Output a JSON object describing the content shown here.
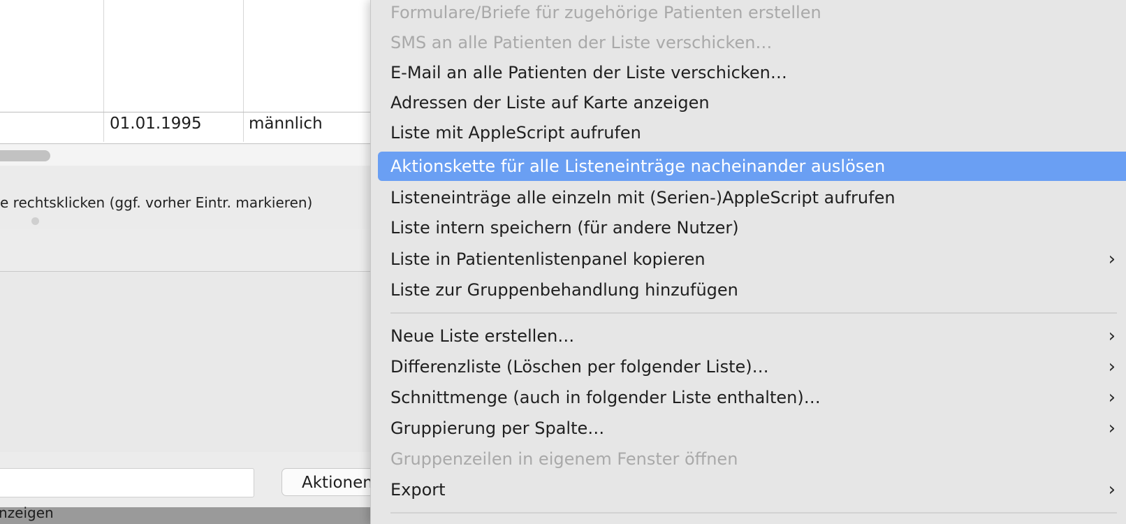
{
  "background_window": {
    "table_row": {
      "date": "01.01.1995",
      "gender": "männlich"
    },
    "hint": "e rechtsklicken (ggf. vorher Eintr. markieren)",
    "action_button_label": "Aktionen",
    "status_text": "nzeigen"
  },
  "context_menu": {
    "items": [
      {
        "label": "Formulare/Briefe für zugehörige Patienten erstellen",
        "enabled": false,
        "submenu": false
      },
      {
        "label": "SMS an alle Patienten der Liste verschicken…",
        "enabled": false,
        "submenu": false
      },
      {
        "label": "E-Mail an alle Patienten der Liste verschicken…",
        "enabled": true,
        "submenu": false
      },
      {
        "label": "Adressen der Liste auf Karte anzeigen",
        "enabled": true,
        "submenu": false
      },
      {
        "label": "Liste mit AppleScript aufrufen",
        "enabled": true,
        "submenu": false
      },
      {
        "label": "Aktionskette für alle Listeneinträge nacheinander auslösen",
        "enabled": true,
        "submenu": false,
        "selected": true
      },
      {
        "label": "Listeneinträge alle einzeln mit (Serien-)AppleScript aufrufen",
        "enabled": true,
        "submenu": false
      },
      {
        "label": "Liste intern speichern (für andere Nutzer)",
        "enabled": true,
        "submenu": false
      },
      {
        "label": "Liste in Patientenlistenpanel kopieren",
        "enabled": true,
        "submenu": true
      },
      {
        "label": "Liste zur Gruppenbehandlung hinzufügen",
        "enabled": true,
        "submenu": false
      },
      {
        "label": "Neue Liste erstellen…",
        "enabled": true,
        "submenu": true
      },
      {
        "label": "Differenzliste (Löschen per folgender Liste)…",
        "enabled": true,
        "submenu": true
      },
      {
        "label": "Schnittmenge (auch in folgender Liste enthalten)…",
        "enabled": true,
        "submenu": true
      },
      {
        "label": "Gruppierung per Spalte…",
        "enabled": true,
        "submenu": true
      },
      {
        "label": "Gruppenzeilen in eigenem Fenster öffnen",
        "enabled": false,
        "submenu": false
      },
      {
        "label": "Export",
        "enabled": true,
        "submenu": true
      }
    ],
    "chevron_icon": "chevron-right-icon",
    "selection_color": "#6a9ff3"
  }
}
